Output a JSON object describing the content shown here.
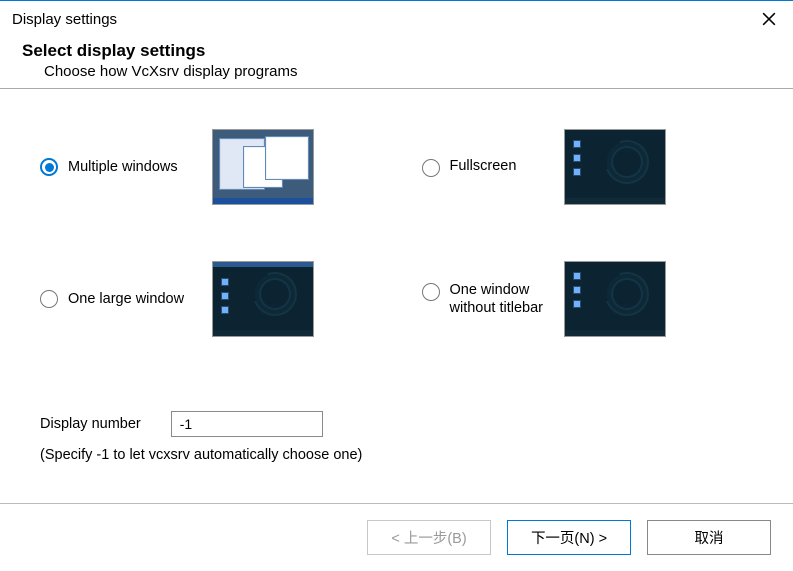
{
  "window": {
    "title": "Display settings"
  },
  "header": {
    "heading": "Select display settings",
    "subheading": "Choose how VcXsrv display programs"
  },
  "options": {
    "multiple_windows": {
      "label": "Multiple windows",
      "selected": true
    },
    "fullscreen": {
      "label": "Fullscreen",
      "selected": false
    },
    "one_large": {
      "label": "One large window",
      "selected": false
    },
    "no_titlebar": {
      "label": "One window without titlebar",
      "selected": false
    }
  },
  "display_number": {
    "label": "Display number",
    "value": "-1",
    "hint": "(Specify -1 to let vcxsrv automatically choose one)"
  },
  "footer": {
    "back": "< 上一步(B)",
    "next": "下一页(N) >",
    "cancel": "取消"
  }
}
